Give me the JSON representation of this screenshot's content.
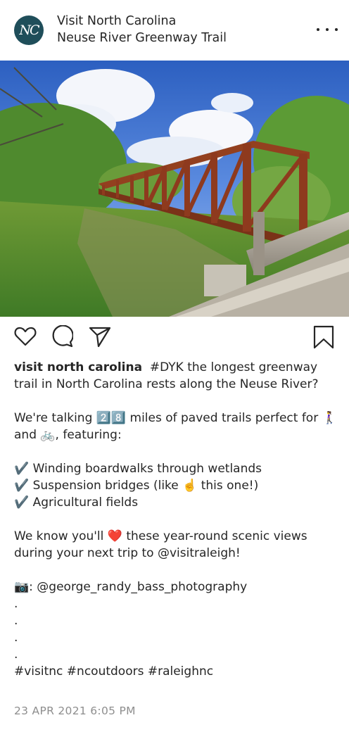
{
  "header": {
    "avatar_text": "NC",
    "account_name": "Visit North Carolina",
    "location": "Neuse River Greenway Trail",
    "more_icon": "more-horizontal-icon"
  },
  "post": {
    "image_subject": "red steel truss bridge over a creek with wooden railing in foreground",
    "actions": [
      "heart-icon",
      "comment-icon",
      "share-icon",
      "bookmark-icon"
    ]
  },
  "caption": {
    "username": "visit north carolina",
    "line1_rest": "#DYK the longest greenway trail in North Carolina rests along the Neuse River?",
    "p2": "We're talking 2️⃣8️⃣ miles of paved trails perfect for 🚶‍♀️ and 🚲, featuring:",
    "bullet1": "✔️ Winding boardwalks through wetlands",
    "bullet2": "✔️ Suspension bridges (like ☝️ this one!)",
    "bullet3": "✔️ Agricultural fields",
    "p4": "We know you'll ❤️ these year-round scenic views during your next trip to @visitraleigh!",
    "credit": "📷: @george_randy_bass_photography",
    "dot": ".",
    "hashtags": "#visitnc #ncoutdoors #raleighnc"
  },
  "date": "23 APR 2021 6:05 PM",
  "colors": {
    "avatar_bg": "#1f4e5a",
    "text": "#262626",
    "muted": "#8e8e8e",
    "bridge": "#8e3a1e"
  }
}
